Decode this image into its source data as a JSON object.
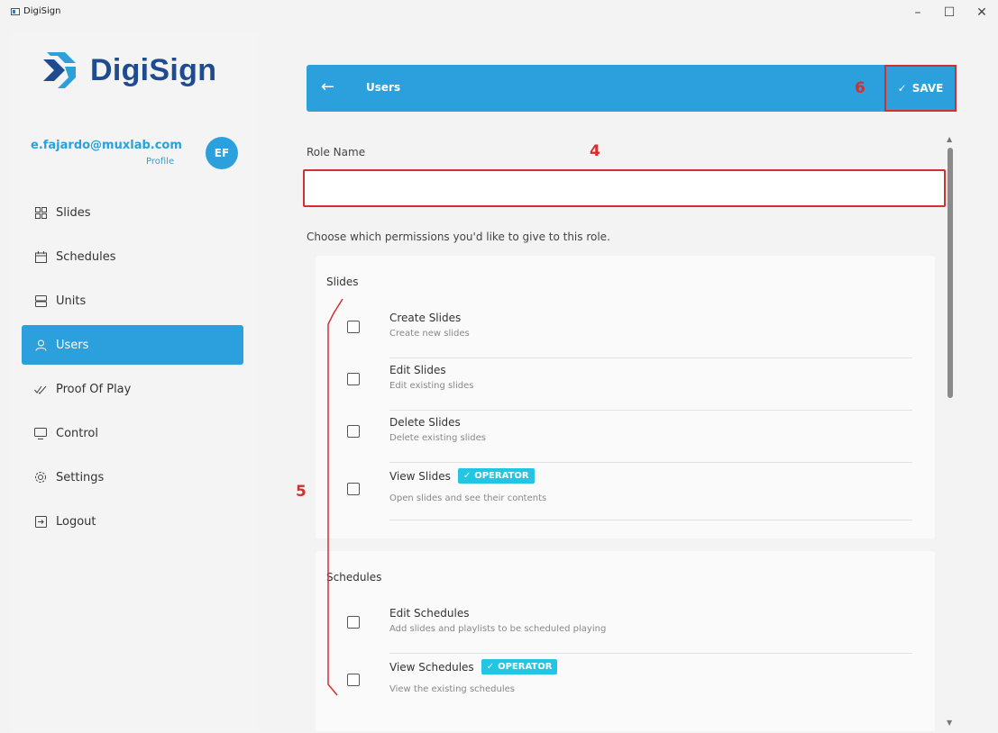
{
  "window": {
    "title": "DigiSign",
    "minimize": "–",
    "maximize": "☐",
    "close": "✕"
  },
  "brand": {
    "name": "DigiSign",
    "color": "#1f4b8f",
    "accent": "#2ba0dc"
  },
  "profile": {
    "email": "e.fajardo@muxlab.com",
    "link": "Profile",
    "initials": "EF"
  },
  "sidebar": {
    "items": [
      {
        "label": "Slides",
        "icon": "grid-icon",
        "active": false
      },
      {
        "label": "Schedules",
        "icon": "calendar-icon",
        "active": false
      },
      {
        "label": "Units",
        "icon": "server-icon",
        "active": false
      },
      {
        "label": "Users",
        "icon": "user-icon",
        "active": true
      },
      {
        "label": "Proof Of Play",
        "icon": "double-check-icon",
        "active": false
      },
      {
        "label": "Control",
        "icon": "monitor-icon",
        "active": false
      },
      {
        "label": "Settings",
        "icon": "gear-icon",
        "active": false
      },
      {
        "label": "Logout",
        "icon": "logout-icon",
        "active": false
      }
    ]
  },
  "header": {
    "title": "Users",
    "save_label": "SAVE"
  },
  "annotations": {
    "six": "6",
    "four": "4",
    "five": "5"
  },
  "form": {
    "role_label": "Role Name",
    "role_value": "",
    "hint": "Choose which permissions you'd like to give to this role."
  },
  "sections": [
    {
      "title": "Slides",
      "permissions": [
        {
          "title": "Create Slides",
          "desc": "Create new slides",
          "badge": ""
        },
        {
          "title": "Edit Slides",
          "desc": "Edit existing slides",
          "badge": ""
        },
        {
          "title": "Delete Slides",
          "desc": "Delete existing slides",
          "badge": ""
        },
        {
          "title": "View Slides",
          "desc": "Open slides and see their contents",
          "badge": "OPERATOR"
        }
      ]
    },
    {
      "title": "Schedules",
      "permissions": [
        {
          "title": "Edit Schedules",
          "desc": "Add slides and playlists to be scheduled playing",
          "badge": ""
        },
        {
          "title": "View Schedules",
          "desc": "View the existing schedules",
          "badge": "OPERATOR"
        }
      ]
    }
  ]
}
